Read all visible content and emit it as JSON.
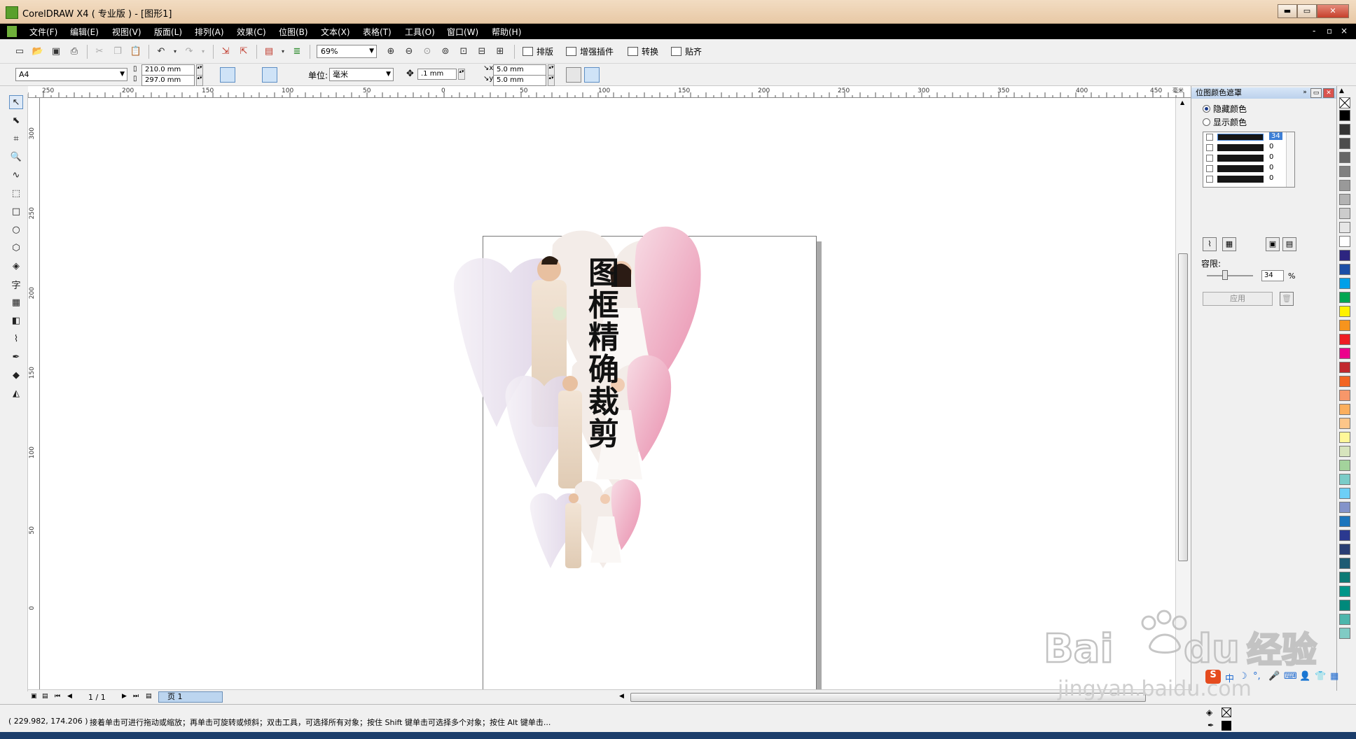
{
  "window": {
    "title": "CorelDRAW X4 ( 专业版 ) - [图形1]",
    "min": "▬",
    "max": "▭",
    "close": "✕"
  },
  "menu": {
    "items": [
      "文件(F)",
      "编辑(E)",
      "视图(V)",
      "版面(L)",
      "排列(A)",
      "效果(C)",
      "位图(B)",
      "文本(X)",
      "表格(T)",
      "工具(O)",
      "窗口(W)",
      "帮助(H)"
    ],
    "mdi_min": "-",
    "mdi_max": "▫",
    "mdi_close": "×"
  },
  "toolbar": {
    "zoom": "69%",
    "buttons": [
      "排版",
      "增强插件",
      "转换",
      "贴齐"
    ]
  },
  "property_bar": {
    "paper": "A4",
    "width": "210.0 mm",
    "height": "297.0 mm",
    "unit_label": "单位:",
    "unit": "毫米",
    "nudge": ".1 mm",
    "dup_x": "5.0 mm",
    "dup_y": "5.0 mm"
  },
  "rulers": {
    "horizontal": [
      "250",
      "200",
      "150",
      "100",
      "50",
      "0",
      "50",
      "100",
      "150",
      "200",
      "250",
      "300",
      "350",
      "400",
      "450"
    ],
    "unit": "毫米",
    "vertical": [
      "300",
      "250",
      "200",
      "150",
      "100",
      "50",
      "0"
    ]
  },
  "page": {
    "text": "图框精确裁剪"
  },
  "page_nav": {
    "count": "1 / 1",
    "tab": "页 1"
  },
  "docker": {
    "title": "位图颜色遮罩",
    "hide_color": "隐藏颜色",
    "show_color": "显示颜色",
    "colors": [
      {
        "value": "34",
        "selected": true
      },
      {
        "value": "0",
        "selected": false
      },
      {
        "value": "0",
        "selected": false
      },
      {
        "value": "0",
        "selected": false
      },
      {
        "value": "0",
        "selected": false
      }
    ],
    "tolerance_label": "容限:",
    "tolerance_value": "34",
    "tolerance_unit": "%",
    "apply": "应用"
  },
  "palette": [
    "#000000",
    "#333333",
    "#4d4d4d",
    "#666666",
    "#808080",
    "#999999",
    "#b3b3b3",
    "#cccccc",
    "#e6e6e6",
    "#ffffff",
    "#2d2580",
    "#1b4ea6",
    "#00a0e9",
    "#00a651",
    "#fff200",
    "#f7941d",
    "#ed1c24",
    "#ec008c",
    "#c1272d",
    "#f26522",
    "#f7976a",
    "#fbaf5d",
    "#fdc689",
    "#fff799",
    "#d7e4bd",
    "#a3d39c",
    "#7accc8",
    "#6dcff6",
    "#8393ca",
    "#1c75bc",
    "#2b3990",
    "#283d73",
    "#1d5b73",
    "#0b7a75",
    "#009688",
    "#00897b",
    "#4db6ac",
    "#80cbc4"
  ],
  "status": {
    "coords": "( 229.982, 174.206 )",
    "message": "接着单击可进行拖动或缩放；再单击可旋转或倾斜；双击工具，可选择所有对象；按住 Shift 键单击可选择多个对象；按住 Alt 键单击..."
  },
  "ime": {
    "label": "中"
  },
  "watermark": {
    "brand": "Bai",
    "brand2": "du",
    "cn": "经验",
    "url": "jingyan.baidu.com"
  }
}
